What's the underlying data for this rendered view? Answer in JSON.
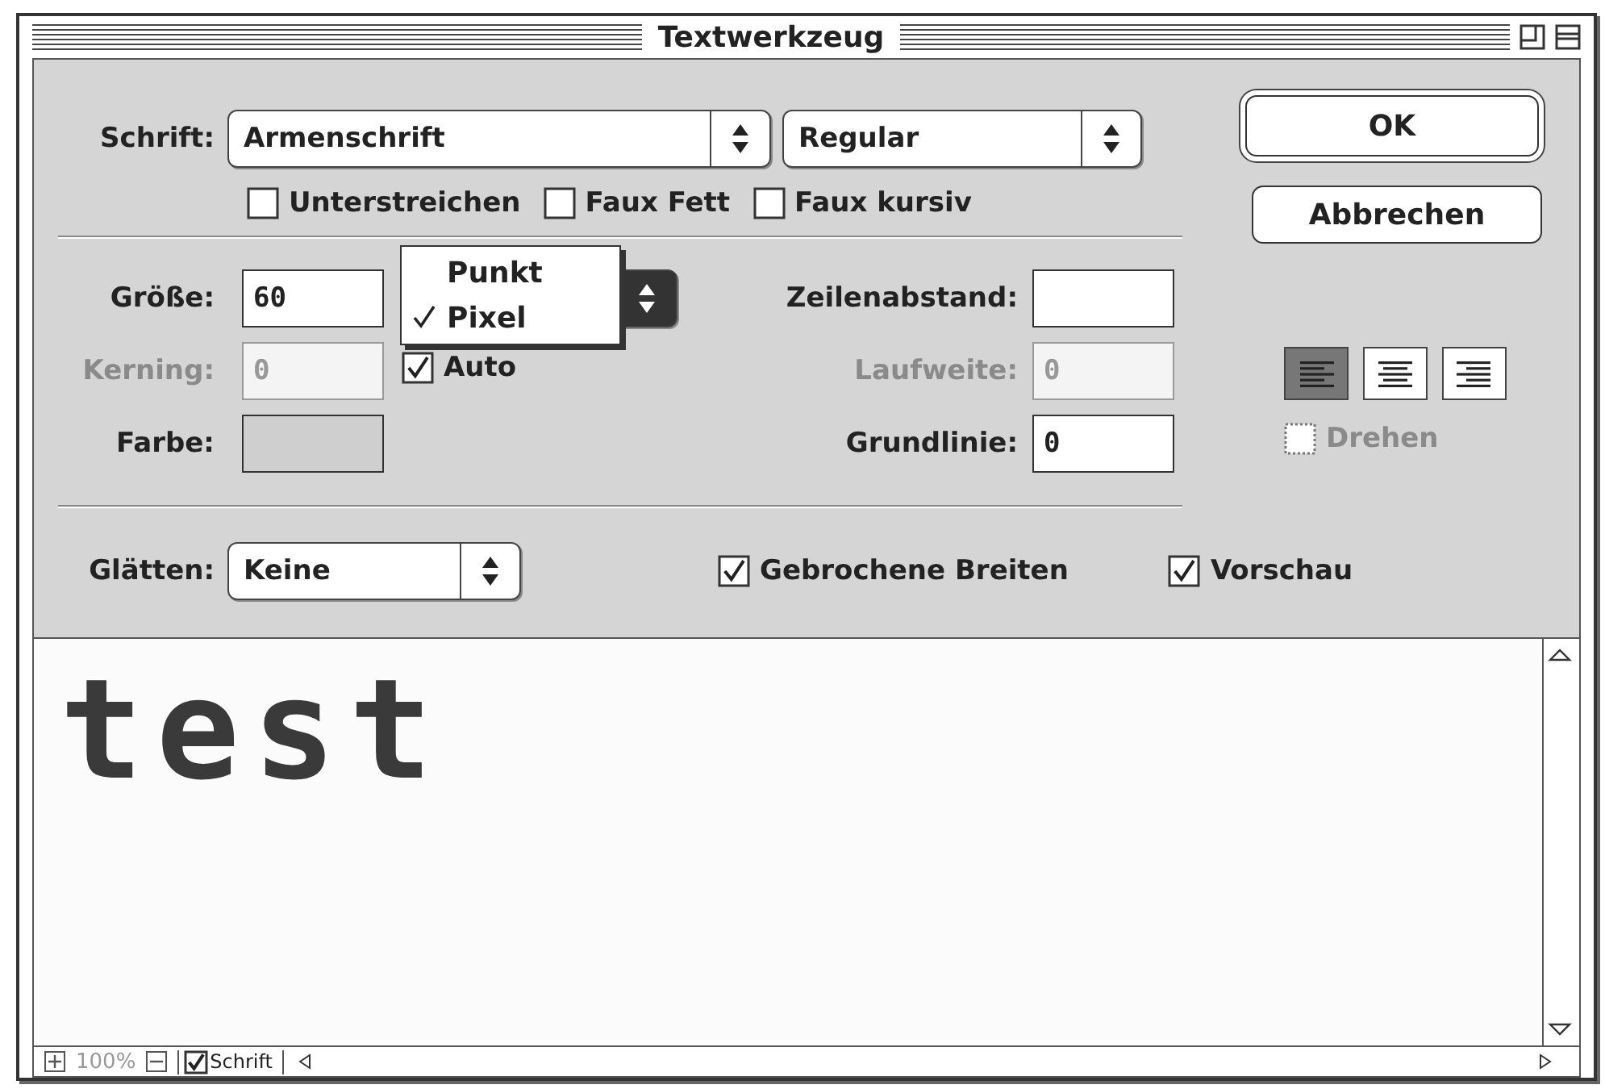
{
  "window": {
    "title": "Textwerkzeug"
  },
  "font": {
    "label": "Schrift:",
    "family": "Armenschrift",
    "style": "Regular"
  },
  "buttons": [
    {
      "label": "OK",
      "default": true
    },
    {
      "label": "Abbrechen",
      "default": false
    }
  ],
  "style_options": [
    {
      "label": "Unterstreichen",
      "checked": false
    },
    {
      "label": "Faux Fett",
      "checked": false
    },
    {
      "label": "Faux kursiv",
      "checked": false
    }
  ],
  "left_fields": [
    {
      "label": "Größe:",
      "kind": "text",
      "value": "60",
      "disabled": false
    },
    {
      "label": "Kerning:",
      "kind": "text",
      "value": "0",
      "disabled": true
    },
    {
      "label": "Farbe:",
      "kind": "swatch",
      "disabled": false
    }
  ],
  "unit_menu": [
    {
      "label": "Punkt",
      "selected": false
    },
    {
      "label": "Pixel",
      "selected": true
    }
  ],
  "kerning_auto": {
    "label": "Auto",
    "checked": true
  },
  "right_fields": [
    {
      "label": "Zeilenabstand:",
      "disabled": false
    },
    {
      "label": "Laufweite:",
      "value": "0",
      "disabled": true
    },
    {
      "label": "Grundlinie:",
      "value": "0",
      "disabled": false
    }
  ],
  "alignment": [
    {
      "kind": "left",
      "selected": true
    },
    {
      "kind": "center",
      "selected": false
    },
    {
      "kind": "right",
      "selected": false
    }
  ],
  "rotate": {
    "label": "Drehen",
    "checked": false,
    "disabled": true
  },
  "smoothing": {
    "label": "Glätten:",
    "value": "Keine"
  },
  "fractional_widths": {
    "label": "Gebrochene Breiten",
    "checked": true
  },
  "preview_toggle": {
    "label": "Vorschau",
    "checked": true
  },
  "preview": {
    "text": "test"
  },
  "status_bar": {
    "zoom": "100%",
    "show_font": {
      "label": "Schrift",
      "checked": true
    }
  }
}
